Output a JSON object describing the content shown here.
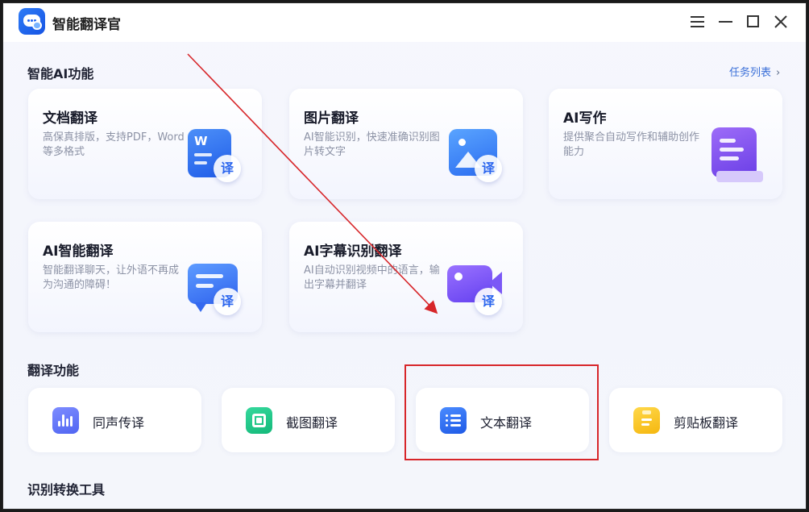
{
  "app": {
    "title": "智能翻译官"
  },
  "window_controls": {
    "menu_icon": "hamburger-menu-icon",
    "minimize_icon": "minimize-icon",
    "maximize_icon": "maximize-icon",
    "close_icon": "close-icon"
  },
  "ai_section": {
    "title": "智能AI功能",
    "task_list_link": "任务列表",
    "cards": [
      {
        "title": "文档翻译",
        "desc": "高保真排版，支持PDF，Word等多格式",
        "icon": "word-document-translate-icon",
        "badge": "译"
      },
      {
        "title": "图片翻译",
        "desc": "AI智能识别，快速准确识别图片转文字",
        "icon": "image-translate-icon",
        "badge": "译"
      },
      {
        "title": "AI写作",
        "desc": "提供聚合自动写作和辅助创作能力",
        "icon": "ai-writing-icon"
      },
      {
        "title": "AI智能翻译",
        "desc": "智能翻译聊天，让外语不再成为沟通的障碍！",
        "icon": "chat-translate-icon",
        "badge": "译"
      },
      {
        "title": "AI字幕识别翻译",
        "desc": "AI自动识别视频中的语言，输出字幕并翻译",
        "icon": "video-subtitle-icon",
        "badge": "译"
      }
    ]
  },
  "translate_section": {
    "title": "翻译功能",
    "buttons": [
      {
        "label": "同声传译",
        "icon": "voice-waveform-icon"
      },
      {
        "label": "截图翻译",
        "icon": "screenshot-crop-icon"
      },
      {
        "label": "文本翻译",
        "icon": "text-list-icon"
      },
      {
        "label": "剪贴板翻译",
        "icon": "clipboard-icon"
      }
    ]
  },
  "tools_section": {
    "title": "识别转换工具"
  },
  "annotation": {
    "highlight_color": "#d7262a",
    "arrow_color": "#d7262a"
  }
}
